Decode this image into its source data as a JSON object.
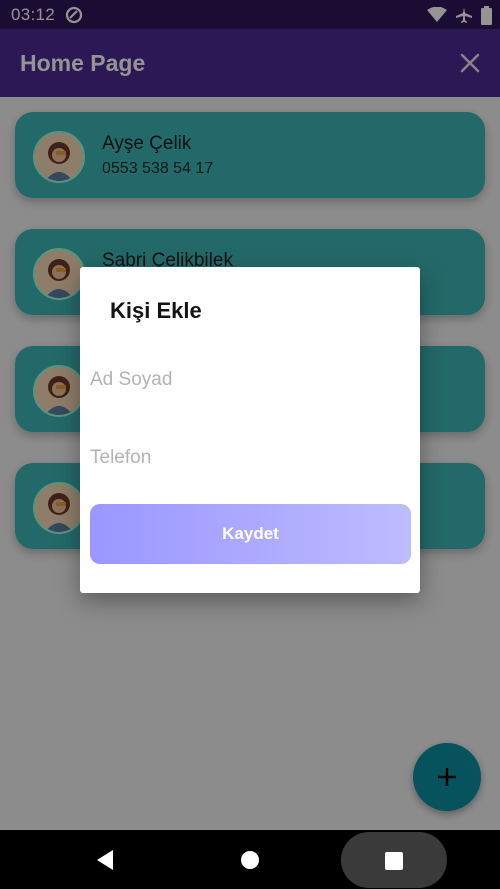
{
  "status_bar": {
    "time": "03:12"
  },
  "app_bar": {
    "title": "Home Page"
  },
  "contacts": [
    {
      "name": "Ayşe Çelik",
      "phone": "0553 538 54 17"
    },
    {
      "name": "Sabri Çelikbilek",
      "phone": ""
    },
    {
      "name": "",
      "phone": ""
    },
    {
      "name": "",
      "phone": ""
    }
  ],
  "dialog": {
    "title": "Kişi Ekle",
    "name_placeholder": "Ad Soyad",
    "phone_placeholder": "Telefon",
    "save_label": "Kaydet"
  },
  "colors": {
    "status_bar": "#2d1657",
    "app_bar": "#4a2a91",
    "card": "#3fb6b6",
    "fab": "#0c8ea0",
    "save_gradient_start": "#9a97ff",
    "save_gradient_end": "#bdbcff"
  },
  "icons": [
    "wifi-icon",
    "airplane-icon",
    "battery-icon",
    "close-icon",
    "add-icon",
    "back-icon",
    "home-icon",
    "recents-icon"
  ]
}
